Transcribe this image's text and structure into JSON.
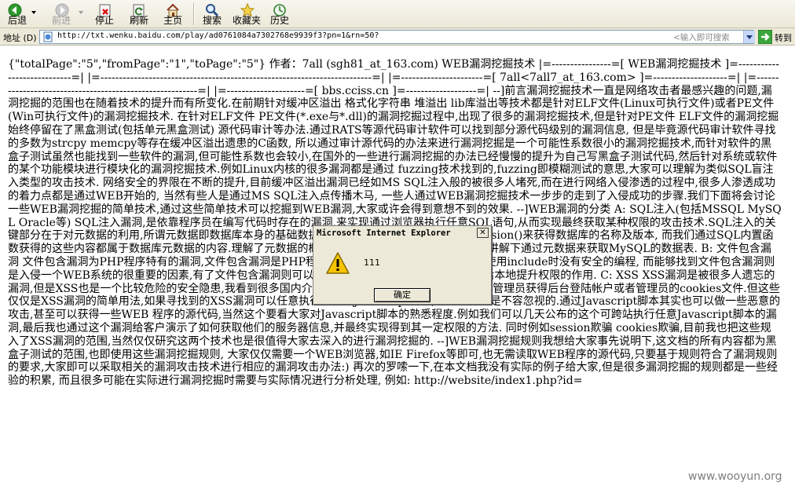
{
  "toolbar": {
    "back_label": "后退",
    "forward_label": "前进",
    "stop_label": "停止",
    "refresh_label": "刷新",
    "home_label": "主页",
    "search_label": "搜索",
    "favorites_label": "收藏夹",
    "history_label": "历史"
  },
  "addressbar": {
    "label": "地址 (D)",
    "url": "http://txt.wenku.baidu.com/play/ad0761084a7302768e9939f3?pn=1&rn=50?",
    "search_hint": "<输入即可搜索",
    "go_label": "转到"
  },
  "document": {
    "text": "{\"totalPage\":\"5\",\"fromPage\":\"1\",\"toPage\":\"5\"} 作者：7all (sgh81_at_163.com) WEB漏洞挖掘技术 |=----------------=[ WEB漏洞挖掘技术 ]=----------------------------=| |=-------------------------------------------------------------------------=| |=----------------------=[ 7all<7all7_at_163.com> ]=--------------------=| |=---------------------------------------------------------=| |=---------------------=[ bbs.cciss.cn ]=-------------------=| --]前言漏洞挖掘技术一直是网络攻击者最感兴趣的问题,漏洞挖掘的范围也在随着技术的提升而有所变化.在前期针对缓冲区溢出 格式化字符串 堆溢出 lib库溢出等技术都是针对ELF文件(Linux可执行文件)或者PE文件(Win可执行文件)的漏洞挖掘技术. 在针对ELF文件 PE文件(*.exe与*.dll)的漏洞挖掘过程中,出现了很多的漏洞挖掘技术,但是针对PE文件 ELF文件的漏洞挖掘始终停留在了黑盒测试(包括单元黑盒测试) 源代码审计等办法.通过RATS等源代码审计软件可以找到部分源代码级别的漏洞信息, 但是毕竟源代码审计软件寻找的多数为strcpy memcpy等存在缓冲区溢出遗患的C函数, 所以通过审计源代码的办法来进行漏洞挖掘是一个可能性系数很小的漏洞挖掘技术,而针对软件的黑盒子测试虽然也能找到一些软件的漏洞,但可能性系数也会较小,在国外的一些进行漏洞挖掘的办法已经慢慢的提升为自己写黑盒子测试代码,然后针对系统或软件的某个功能模块进行模块化的漏洞挖掘技术.例如Linux内核的很多漏洞都是通过 fuzzing技术找到的,fuzzing即模糊测试的意思,大家可以理解为类似SQL盲注入类型的攻击技术. 网络安全的界限在不断的提升,目前缓冲区溢出漏洞已经如MS SQL注入般的被很多人堵死,而在进行网络入侵渗透的过程中,很多人渗透成功的着力点都是通过WEB开始的, 当然有些人是通过MS SQL注入点传播木马, 一些人通过WEB漏洞挖掘技术一步步的走到了入侵成功的步骤.我们下面将会讨论一些WEB漏洞挖掘的简单技术,通过这些简单技术可以挖掘到WEB漏洞,大家或许会得到意想不到的效果. --]WEB漏洞的分类 A: SQL注入(包括MSSQL MySQL Oracle等) SQL注入漏洞,是依靠程序员在编写代码时存在的漏洞,来实现通过浏览器执行任意SQL语句,从而实现最终获取某种权限的攻击技术.SQL注入的关键部分在于对元数据的利用,所谓元数据即数据库本身的基础数据.例如我们可以通过database() version()来获得数据库的名称及版本, 而我们通过SQL内置函数获得的这些内容都属于数据库元数据的内容.理解了元数据的概念,在后面的章节我会给大家简单的讲解下通过元数据来获取MySQL的数据表. B: 文件包含漏洞 文件包含漏洞为PHP程序特有的漏洞,文件包含漏洞是PHP程序特有的一个弱点攻击,原理就是在使用include时没有安全的编程, 而能够找到文件包含漏洞则是入侵一个WEB系统的很重要的因素,有了文件包含漏洞则可以很快速的达到上传WEBSHELL,然后本地提升权限的作用. C: XSS XSS漏洞是被很多人遗忘的漏洞,但是XSS也是一个比较危险的安全隐患,我看到很多国内介绍 XSS漏洞的文章大部分在如何欺骗管理员获得后台登陆帐户或者管理员的cookies文件.但这些仅仅是XSS漏洞的简单用法,如果寻找到的XSS漏洞可以任意执行任何的Javascript脚本,那安全性也是不容忽视的.通过Javascript脚本其实也可以做一些恶意的攻击,甚至可以获得一些WEB 程序的源代码,当然这个要看大家对Javascript脚本的熟悉程度.例如我们可以几天公布的这个可跨站执行任意Javascript脚本的漏洞,最后我也通过这个漏洞给客户演示了如何获取他们的服务器信息,并最终实现得到其一定权限的方法. 同时例如session欺骗 cookies欺骗,目前我也把这些规入了XSS漏洞的范围,当然仅仅研究这两个技术也是很值得大家去深入的进行漏洞挖掘的. --]WEB漏洞挖掘规则我想给大家事先说明下,这文档的所有内容都为黑盒子测试的范围,也即使用这些漏洞挖掘规则, 大家仅仅需要一个WEB浏览器,如IE Firefox等即可,也无需读取WEB程序的源代码,只要基于规则符合了漏洞规则的要求,大家即可以采取相关的漏洞攻击技术进行相应的漏洞攻击办法:) 再次的罗嗦一下,在本文档我没有实际的例子给大家,但是很多漏洞挖掘的规则都是一些经验的积累, 而且很多可能在实际进行漏洞挖掘时需要与实际情况进行分析处理, 例如: http://website/index1.php?id="
  },
  "dialog": {
    "title": "Microsoft Internet Explorer",
    "message": "111",
    "ok_label": "确定"
  },
  "watermark": "www.wooyun.org",
  "colors": {
    "chrome": "#ece9d8",
    "titlebar": "#ece9d8",
    "text": "#000000",
    "back_icon": "#2e9a2e",
    "warning_icon": "#f5c400"
  }
}
